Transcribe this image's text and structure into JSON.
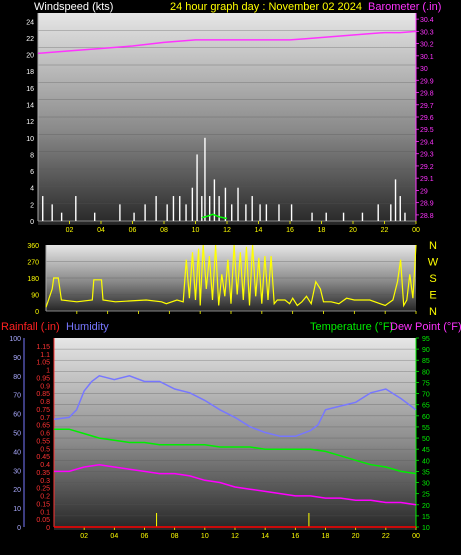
{
  "header": {
    "wind_title": "Windspeed (kts)",
    "graph_title": "24 hour graph day : November 02 2024",
    "baro_title": "Barometer (.in)"
  },
  "lower_header": {
    "rain_title": "Rainfall (.in)",
    "hum_title": "Humidity",
    "temp_title": "Temperature (°F)",
    "dew_title": "Dew Point (°F)"
  },
  "colors": {
    "wind": "#ffffff",
    "baro": "#ff33ff",
    "dir": "#ffff00",
    "gust": "#00ff00",
    "humidity": "#7777ff",
    "temperature": "#00ee00",
    "dewpoint": "#ff00ff",
    "rain": "#ff0000",
    "axis_yellow": "#ffff00"
  },
  "x_ticks": [
    "02",
    "04",
    "06",
    "08",
    "10",
    "12",
    "14",
    "16",
    "18",
    "20",
    "22",
    "00"
  ],
  "chart_data": [
    {
      "type": "line",
      "title": "Windspeed (kts) / Barometer (.in)",
      "x_unit": "hours",
      "x_range": [
        0,
        24
      ],
      "left_axis": {
        "label": "Windspeed (kts)",
        "ticks": [
          0,
          2,
          4,
          6,
          8,
          10,
          12,
          14,
          16,
          18,
          20,
          22,
          24
        ],
        "ylim": [
          0,
          25
        ]
      },
      "right_axis": {
        "label": "Barometer (.in)",
        "ticks": [
          "28.8",
          "28.9",
          "29",
          "29.1",
          "29.2",
          "29.3",
          "29.4",
          "29.5",
          "29.6",
          "29.7",
          "29.8",
          "29.9",
          "30",
          "30.1",
          "30.2",
          "30.3",
          "30.4"
        ],
        "ylim": [
          28.75,
          30.45
        ]
      },
      "series": [
        {
          "name": "Barometer (.in)",
          "axis": "right",
          "x": [
            0,
            2,
            4,
            6,
            8,
            9,
            10,
            12,
            14,
            16,
            17,
            18,
            20,
            21,
            22,
            23,
            24
          ],
          "y": [
            30.12,
            30.14,
            30.16,
            30.18,
            30.21,
            30.22,
            30.23,
            30.23,
            30.23,
            30.23,
            30.24,
            30.25,
            30.27,
            30.28,
            30.29,
            30.29,
            30.3
          ]
        },
        {
          "name": "Windspeed (kts)",
          "axis": "left",
          "style": "bars",
          "x": [
            0.3,
            0.9,
            1.5,
            2.4,
            3.6,
            5.2,
            6.1,
            6.8,
            7.5,
            8.2,
            8.6,
            9.0,
            9.4,
            9.8,
            10.1,
            10.4,
            10.6,
            10.9,
            11.2,
            11.5,
            11.9,
            12.3,
            12.7,
            13.2,
            13.6,
            14.1,
            14.5,
            15.3,
            16.1,
            17.4,
            18.3,
            19.4,
            20.6,
            21.6,
            22.4,
            22.7,
            23.0,
            23.3
          ],
          "y": [
            3,
            2,
            1,
            3,
            1,
            2,
            1,
            2,
            3,
            2,
            3,
            3,
            2,
            4,
            8,
            3,
            10,
            3,
            5,
            3,
            4,
            2,
            4,
            2,
            3,
            2,
            2,
            2,
            2,
            1,
            1,
            1,
            1,
            2,
            2,
            5,
            3,
            1
          ]
        },
        {
          "name": "Wind gust",
          "axis": "left",
          "style": "line",
          "x": [
            10.4,
            10.8,
            11.1,
            11.5,
            12.0
          ],
          "y": [
            0.4,
            0.6,
            0.8,
            0.5,
            0.3
          ]
        }
      ]
    },
    {
      "type": "line",
      "title": "Wind direction",
      "x_unit": "hours",
      "x_range": [
        0,
        24
      ],
      "left_axis": {
        "ticks": [
          0,
          90,
          180,
          270,
          360
        ],
        "ylim": [
          0,
          360
        ]
      },
      "right_axis": {
        "ticks": [
          "N",
          "E",
          "S",
          "W",
          "N"
        ]
      },
      "series": [
        {
          "name": "Wind direction",
          "x": [
            0,
            0.4,
            0.5,
            0.8,
            1.0,
            2.0,
            3.0,
            3.1,
            3.6,
            3.7,
            4.5,
            5.5,
            6.5,
            7.5,
            7.8,
            8.5,
            8.9,
            9.1,
            9.3,
            9.5,
            9.7,
            9.9,
            10.0,
            10.2,
            10.4,
            10.6,
            10.8,
            11.0,
            11.2,
            11.4,
            11.6,
            11.8,
            12.0,
            12.2,
            12.4,
            12.6,
            12.8,
            13.0,
            13.2,
            13.4,
            13.6,
            13.8,
            14.0,
            14.2,
            14.4,
            14.6,
            14.8,
            15.0,
            15.5,
            15.8,
            16.0,
            16.3,
            16.6,
            16.9,
            17.2,
            17.5,
            17.8,
            18.0,
            18.5,
            19.0,
            19.5,
            20.0,
            21.0,
            22.0,
            22.5,
            22.8,
            23.0,
            23.2,
            23.4,
            23.6,
            23.8,
            24
          ],
          "y": [
            20,
            120,
            180,
            180,
            60,
            50,
            60,
            170,
            170,
            60,
            50,
            55,
            60,
            50,
            40,
            60,
            50,
            280,
            70,
            320,
            60,
            340,
            30,
            360,
            120,
            300,
            60,
            360,
            30,
            200,
            80,
            280,
            40,
            360,
            90,
            320,
            60,
            350,
            30,
            360,
            80,
            290,
            40,
            300,
            60,
            300,
            40,
            60,
            60,
            40,
            70,
            30,
            50,
            80,
            40,
            160,
            120,
            50,
            50,
            40,
            70,
            60,
            60,
            30,
            60,
            160,
            280,
            30,
            60,
            200,
            70,
            360
          ]
        }
      ]
    },
    {
      "type": "line",
      "title": "Humidity / Temperature (°F) / Dew Point (°F) / Rainfall (.in)",
      "x_unit": "hours",
      "x_range": [
        0,
        24
      ],
      "left_axis_rain": {
        "label": "Rainfall (.in)",
        "ticks": [
          "0",
          "0.05",
          "0.1",
          "0.15",
          "0.2",
          "0.25",
          "0.3",
          "0.35",
          "0.4",
          "0.45",
          "0.5",
          "0.55",
          "0.6",
          "0.65",
          "0.7",
          "0.75",
          "0.8",
          "0.85",
          "0.9",
          "0.95",
          "1",
          "1.05",
          "1.1",
          "1.15"
        ],
        "ylim": [
          0,
          1.2
        ]
      },
      "left_axis_humidity": {
        "label": "Humidity",
        "ticks": [
          0,
          10,
          20,
          30,
          40,
          50,
          60,
          70,
          80,
          90,
          100
        ],
        "ylim": [
          0,
          100
        ]
      },
      "right_axis": {
        "label": "Temperature (°F)",
        "ticks": [
          10,
          15,
          20,
          25,
          30,
          35,
          40,
          45,
          50,
          55,
          60,
          65,
          70,
          75,
          80,
          85,
          90,
          95
        ],
        "ylim": [
          10,
          95
        ]
      },
      "series": [
        {
          "name": "Humidity",
          "axis": "humidity",
          "x": [
            0,
            1,
            1.5,
            2,
            2.5,
            3,
            3.5,
            4,
            5,
            6,
            7,
            8,
            9,
            10,
            11,
            12,
            13,
            14,
            15,
            16,
            17,
            17.5,
            18,
            19,
            20,
            21,
            22,
            23,
            24
          ],
          "y": [
            57,
            58,
            62,
            72,
            77,
            80,
            79,
            78,
            80,
            77,
            77,
            73,
            71,
            67,
            62,
            58,
            53,
            50,
            48,
            48,
            51,
            54,
            62,
            64,
            66,
            71,
            73,
            68,
            62
          ]
        },
        {
          "name": "Temperature (°F)",
          "axis": "right",
          "x": [
            0,
            1,
            2,
            3,
            4,
            5,
            6,
            7,
            8,
            9,
            10,
            11,
            12,
            13,
            14,
            15,
            16,
            17,
            18,
            19,
            20,
            21,
            22,
            23,
            24
          ],
          "y": [
            54,
            54,
            52,
            50,
            49,
            48,
            48,
            47,
            47,
            47,
            47,
            46,
            46,
            46,
            45,
            45,
            45,
            45,
            44,
            42,
            40,
            38,
            37,
            35,
            34
          ]
        },
        {
          "name": "Dew Point (°F)",
          "axis": "right",
          "x": [
            0,
            1,
            2,
            3,
            4,
            5,
            6,
            7,
            8,
            9,
            10,
            11,
            12,
            13,
            14,
            15,
            16,
            17,
            18,
            19,
            20,
            21,
            22,
            23,
            24
          ],
          "y": [
            35,
            35,
            37,
            38,
            37,
            36,
            35,
            34,
            34,
            33,
            31,
            30,
            28,
            27,
            26,
            25,
            24,
            24,
            23,
            23,
            22,
            22,
            21,
            21,
            20
          ]
        },
        {
          "name": "Rainfall (.in)",
          "axis": "rain",
          "x": [
            0,
            24
          ],
          "y": [
            0,
            0
          ]
        }
      ]
    }
  ]
}
